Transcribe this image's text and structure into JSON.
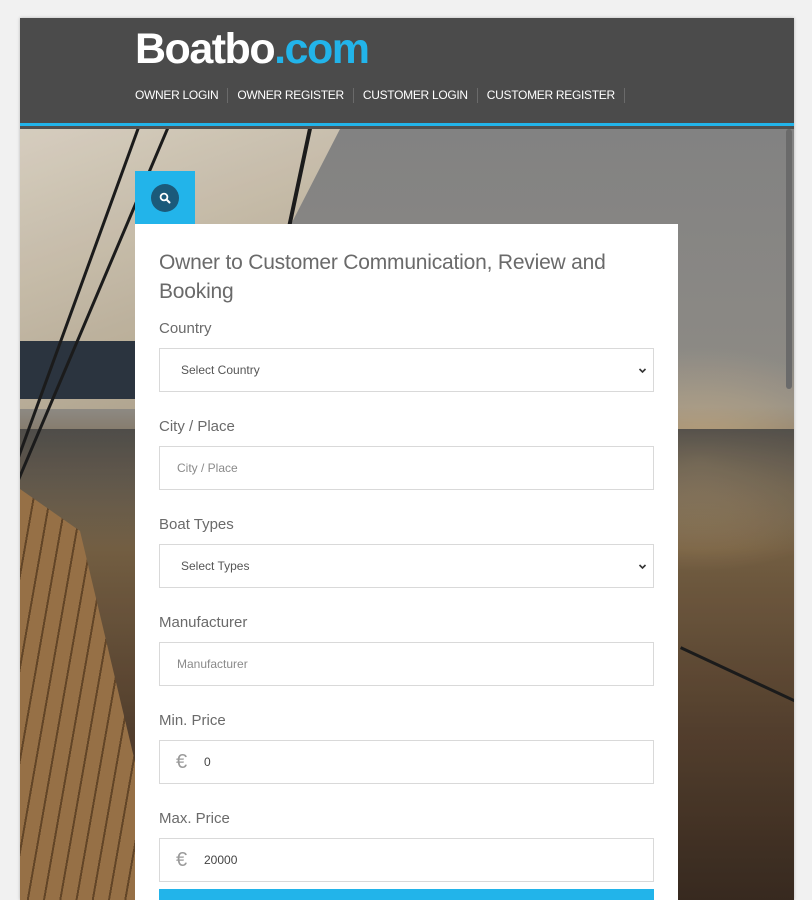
{
  "brand": {
    "name_white": "Boatbo",
    "name_blue": ".com"
  },
  "nav": [
    {
      "label": "OWNER LOGIN"
    },
    {
      "label": "OWNER REGISTER"
    },
    {
      "label": "CUSTOMER LOGIN"
    },
    {
      "label": "CUSTOMER REGISTER"
    }
  ],
  "search": {
    "icon": "search-icon",
    "title": "Owner to Customer Communication, Review and Booking",
    "country": {
      "label": "Country",
      "value": "Select Country"
    },
    "city": {
      "label": "City / Place",
      "placeholder": "City / Place"
    },
    "boat_types": {
      "label": "Boat Types",
      "value": "Select Types"
    },
    "manufacturer": {
      "label": "Manufacturer",
      "placeholder": "Manufacturer"
    },
    "min_price": {
      "label": "Min. Price",
      "currency": "€",
      "value": "0"
    },
    "max_price": {
      "label": "Max. Price",
      "currency": "€",
      "value": "20000"
    }
  },
  "colors": {
    "accent": "#22b4ea",
    "header_bg": "#4b4b4b",
    "panel_bg": "#ffffff"
  }
}
